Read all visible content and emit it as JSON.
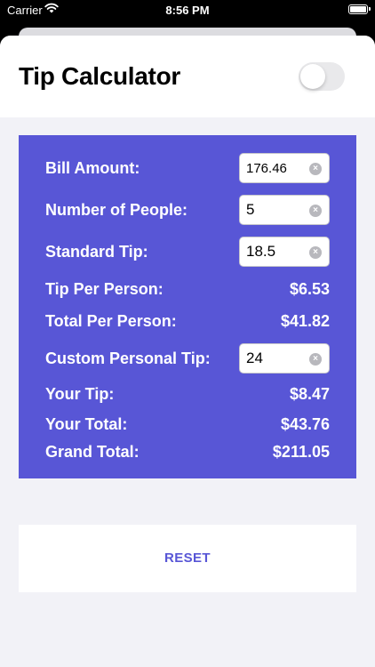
{
  "status_bar": {
    "carrier": "Carrier",
    "time": "8:56 PM"
  },
  "header": {
    "title": "Tip Calculator",
    "toggle_on": false
  },
  "colors": {
    "accent": "#5856d6",
    "background": "#f2f2f7",
    "card_text": "#ffffff"
  },
  "form": {
    "bill_amount": {
      "label": "Bill Amount:",
      "value": "176.46"
    },
    "people": {
      "label": "Number of People:",
      "value": "5"
    },
    "standard_tip": {
      "label": "Standard Tip:",
      "value": "18.5"
    },
    "tip_per_person": {
      "label": "Tip Per Person:",
      "value": "$6.53"
    },
    "total_per_person": {
      "label": "Total Per Person:",
      "value": "$41.82"
    },
    "custom_tip": {
      "label": "Custom Personal Tip:",
      "value": "24"
    },
    "your_tip": {
      "label": "Your Tip:",
      "value": "$8.47"
    },
    "your_total": {
      "label": "Your Total:",
      "value": "$43.76"
    },
    "grand_total": {
      "label": "Grand Total:",
      "value": "$211.05"
    }
  },
  "actions": {
    "reset_label": "RESET"
  },
  "icons": {
    "clear": "clear-icon",
    "wifi": "wifi-icon",
    "battery": "battery-icon"
  }
}
